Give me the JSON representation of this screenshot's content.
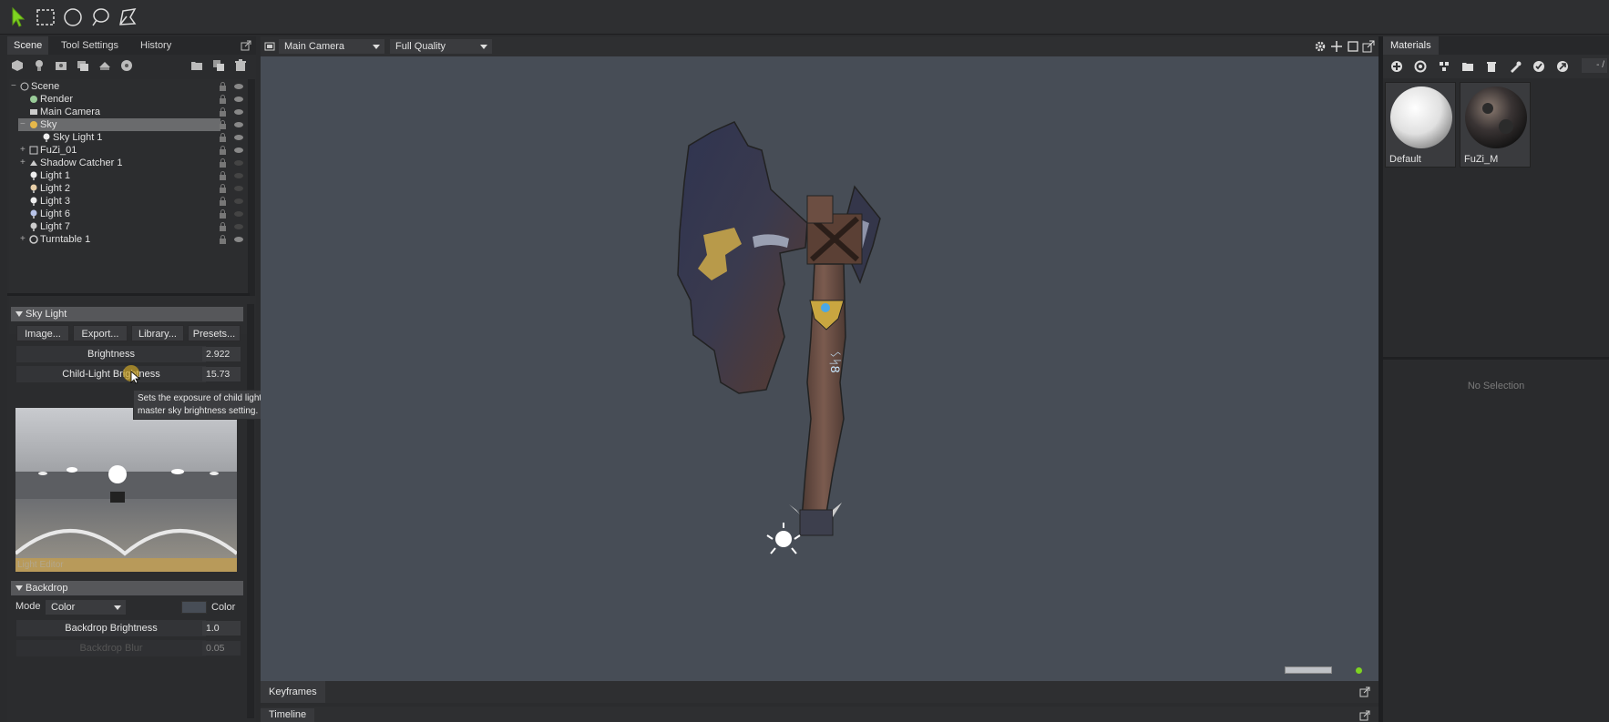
{
  "toolbar": {
    "tools": [
      "select-arrow-icon",
      "rect-select-icon",
      "ellipse-select-icon",
      "lasso-select-icon",
      "polygon-select-icon"
    ]
  },
  "left_tabs": {
    "scene": "Scene",
    "tool_settings": "Tool Settings",
    "history": "History"
  },
  "scene_tree": {
    "rows": [
      {
        "label": "Scene",
        "icon": "scene-icon",
        "indent": 0
      },
      {
        "label": "Render",
        "icon": "render-icon",
        "indent": 1
      },
      {
        "label": "Main Camera",
        "icon": "camera-icon",
        "indent": 1
      },
      {
        "label": "Sky",
        "icon": "sky-icon",
        "indent": 1,
        "selected": true
      },
      {
        "label": "Sky Light 1",
        "icon": "light-bulb-icon",
        "indent": 2
      },
      {
        "label": "FuZi_01",
        "icon": "mesh-icon",
        "indent": 1
      },
      {
        "label": "Shadow Catcher 1",
        "icon": "shadow-catcher-icon",
        "indent": 1
      },
      {
        "label": "Light 1",
        "icon": "light-bulb-icon",
        "indent": 1
      },
      {
        "label": "Light 2",
        "icon": "light-bulb-icon",
        "indent": 1
      },
      {
        "label": "Light 3",
        "icon": "light-bulb-icon",
        "indent": 1
      },
      {
        "label": "Light 6",
        "icon": "light-bulb-icon",
        "indent": 1
      },
      {
        "label": "Light 7",
        "icon": "light-bulb-icon",
        "indent": 1
      },
      {
        "label": "Turntable 1",
        "icon": "turntable-icon",
        "indent": 1
      }
    ]
  },
  "sky_light": {
    "header": "Sky Light",
    "buttons": [
      "Image...",
      "Export...",
      "Library...",
      "Presets..."
    ],
    "brightness_label": "Brightness",
    "brightness_value": "2.922",
    "child_light_label": "Child-Light Brightness",
    "child_light_value": "15.73",
    "tooltip": "Sets the exposure of child lights in relation to the master sky brightness setting.",
    "preview_caption": "Light Editor"
  },
  "backdrop": {
    "header": "Backdrop",
    "mode_label": "Mode",
    "mode_value": "Color",
    "color_label": "Color",
    "brightness_label": "Backdrop Brightness",
    "brightness_value": "1.0",
    "blur_label": "Backdrop Blur",
    "blur_value": "0.05"
  },
  "viewport": {
    "camera": "Main Camera",
    "quality": "Full Quality",
    "background_color": "#474d56"
  },
  "materials": {
    "tab": "Materials",
    "items": [
      "Default",
      "FuZi_M"
    ],
    "page": "- /",
    "no_selection": "No Selection"
  },
  "bottom": {
    "keyframes": "Keyframes",
    "timeline": "Timeline"
  }
}
